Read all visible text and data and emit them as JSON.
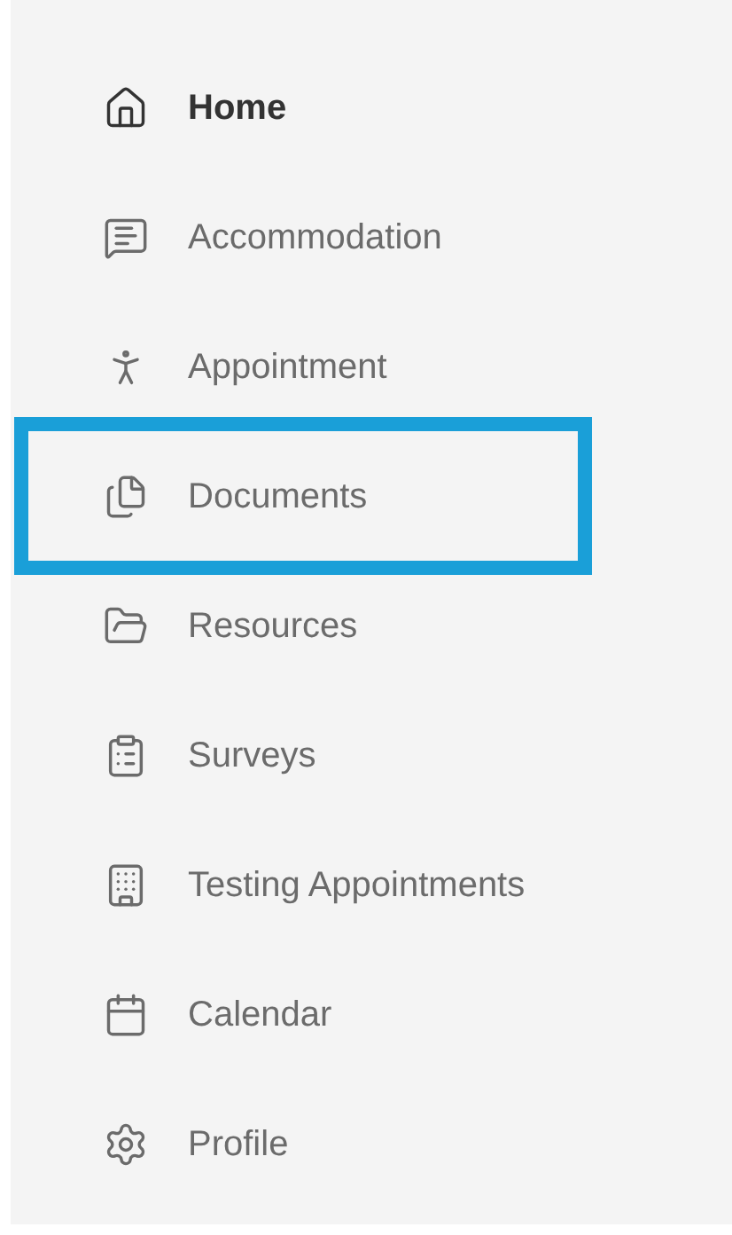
{
  "sidebar": {
    "items": [
      {
        "label": "Home",
        "selected": true,
        "highlighted": false
      },
      {
        "label": "Accommodation",
        "selected": false,
        "highlighted": false
      },
      {
        "label": "Appointment",
        "selected": false,
        "highlighted": false
      },
      {
        "label": "Documents",
        "selected": false,
        "highlighted": true
      },
      {
        "label": "Resources",
        "selected": false,
        "highlighted": false
      },
      {
        "label": "Surveys",
        "selected": false,
        "highlighted": false
      },
      {
        "label": "Testing Appointments",
        "selected": false,
        "highlighted": false
      },
      {
        "label": "Calendar",
        "selected": false,
        "highlighted": false
      },
      {
        "label": "Profile",
        "selected": false,
        "highlighted": false
      }
    ]
  }
}
